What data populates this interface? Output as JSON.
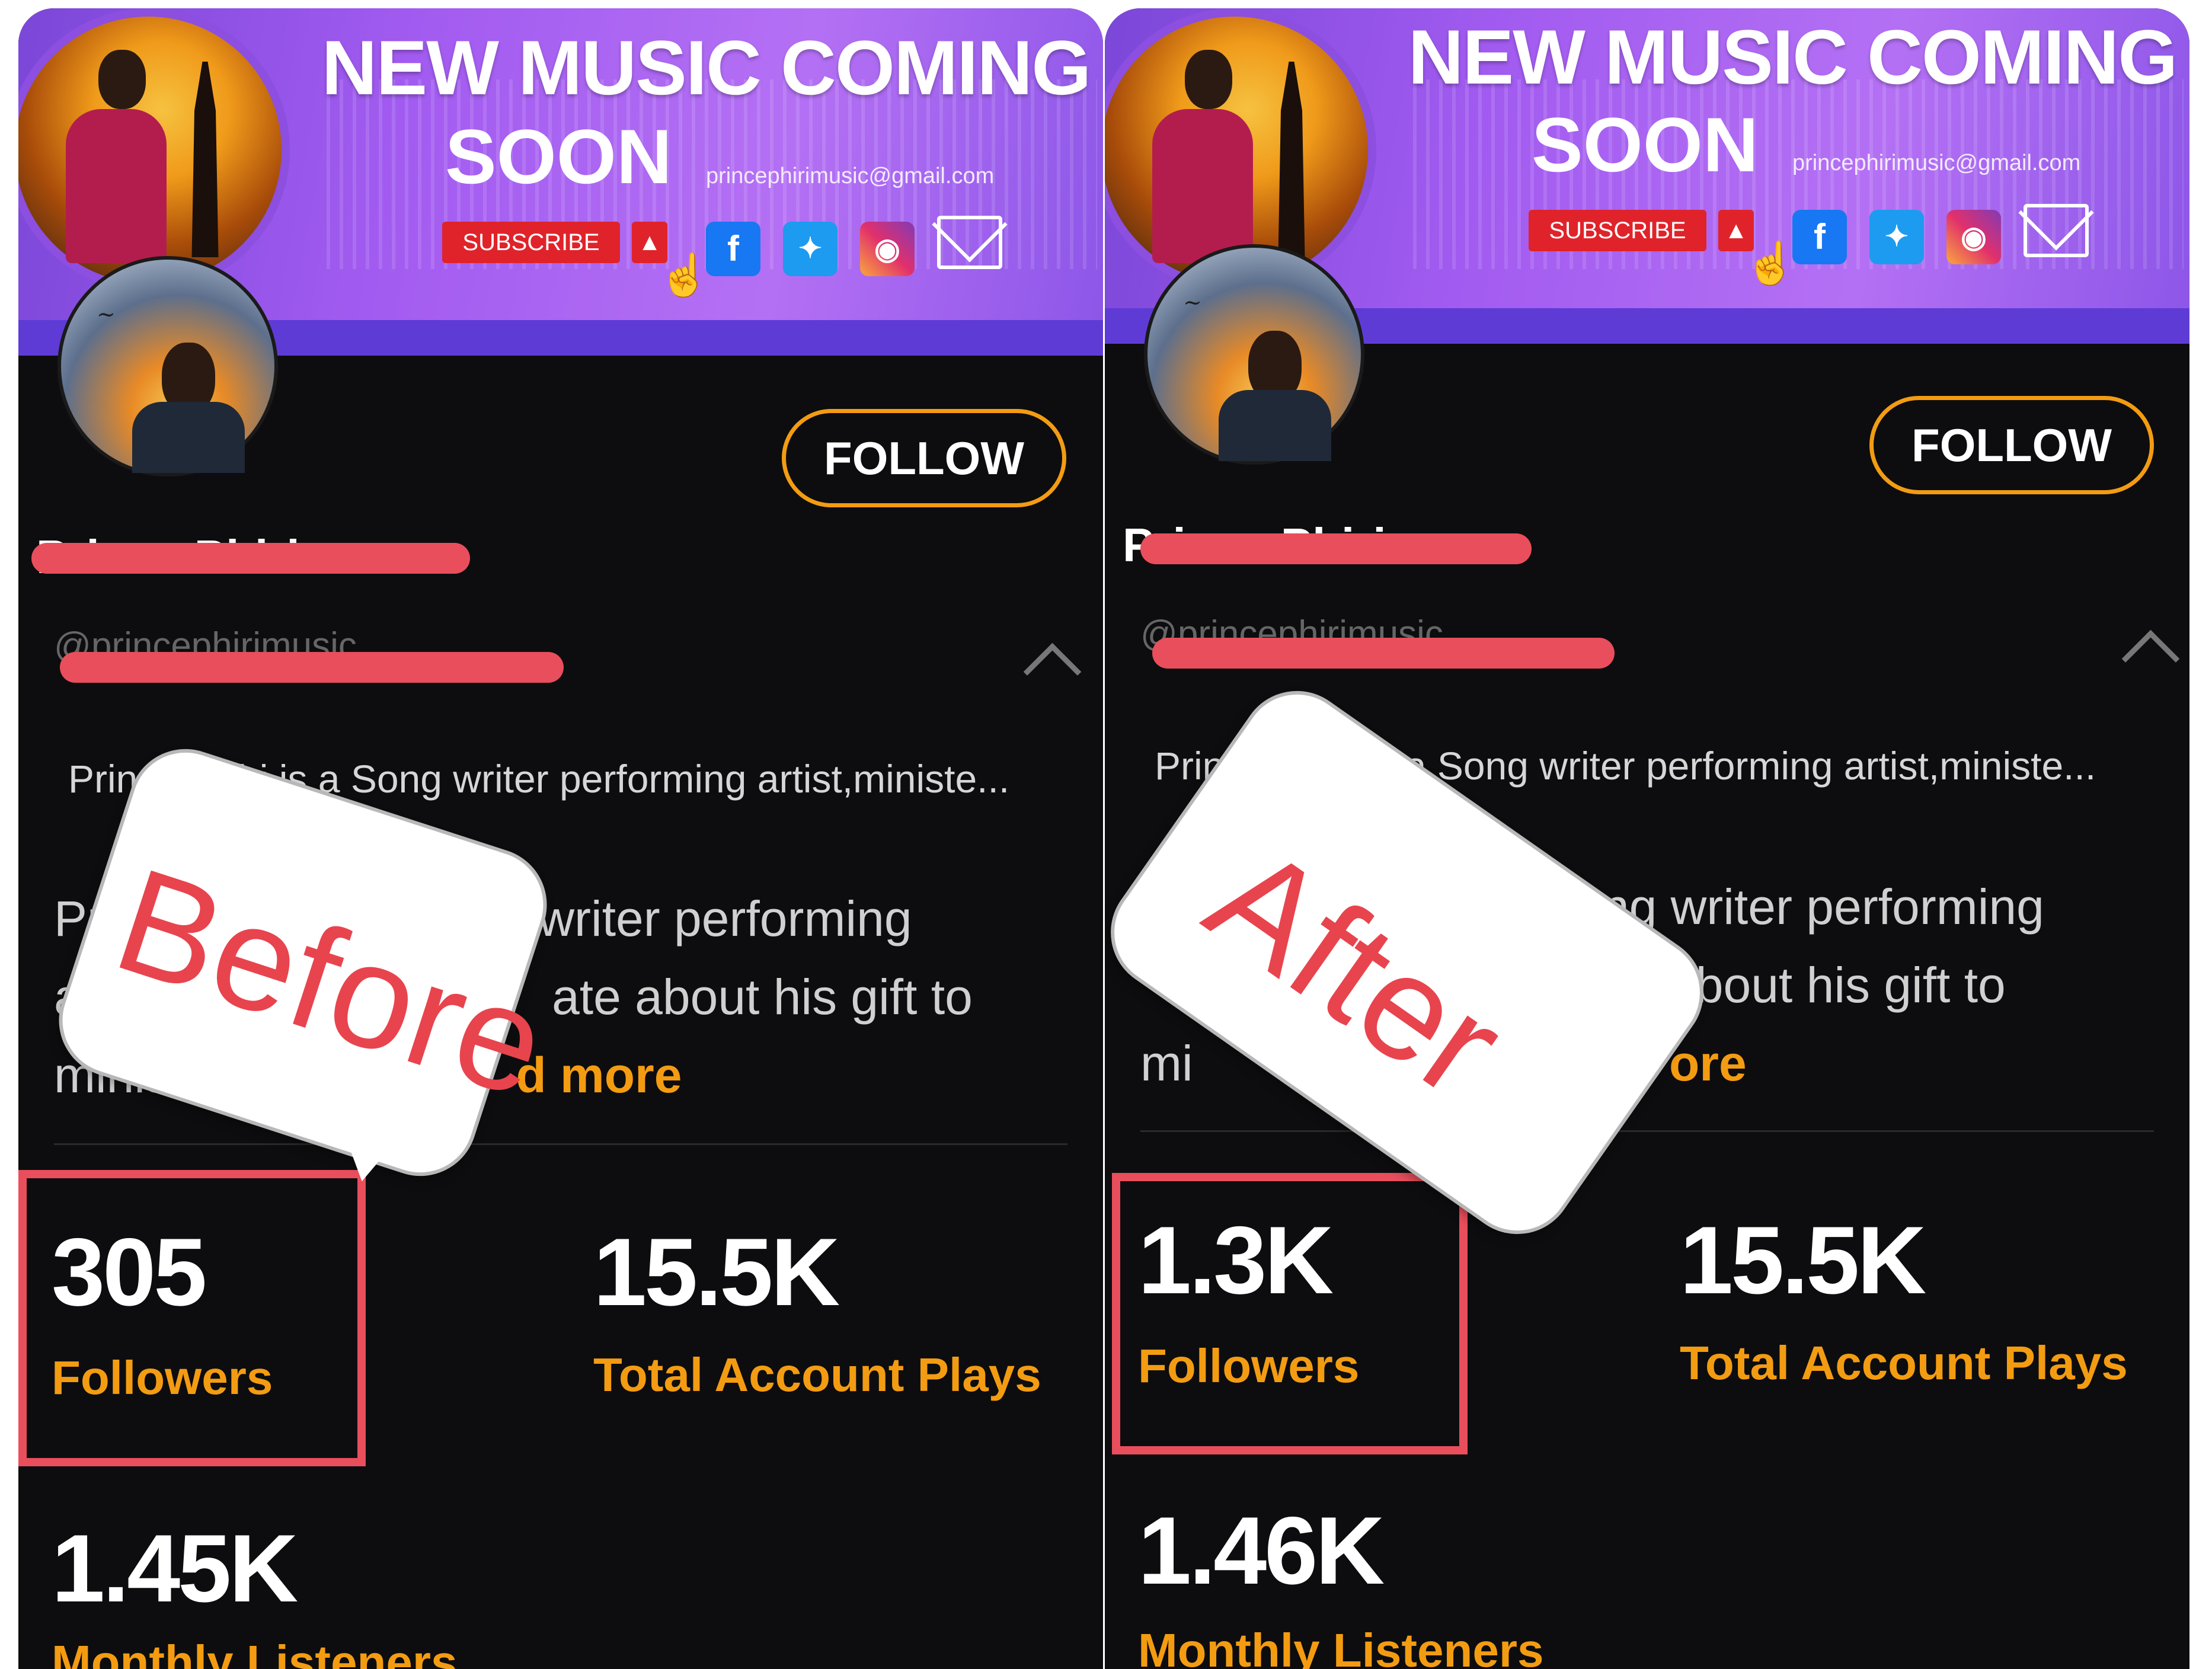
{
  "panels": {
    "before": {
      "banner": {
        "title_line1": "NEW MUSIC COMING",
        "title_line2": "SOON",
        "email": "princephirimusic@gmail.com",
        "subscribe_label": "SUBSCRIBE"
      },
      "follow_label": "FOLLOW",
      "profile_name": "Prince Phiri",
      "handle": "@princephirimusic",
      "bio_short": "Prince Phiri is a Song writer performing artist,ministe...",
      "bio_full_line1": "Pr",
      "bio_full_line1b": "g writer performing",
      "bio_full_line2": "a",
      "bio_full_line2b": "ate about his gift to",
      "bio_full_line3": "minis",
      "read_more": "d more",
      "followers_value": "305",
      "followers_label": "Followers",
      "plays_value": "15.5K",
      "plays_label": "Total Account Plays",
      "listeners_value": "1.45K",
      "listeners_label": "Monthly Listeners",
      "callout": "Before"
    },
    "after": {
      "banner": {
        "title_line1": "NEW MUSIC COMING",
        "title_line2": "SOON",
        "email": "princephirimusic@gmail.com",
        "subscribe_label": "SUBSCRIBE"
      },
      "follow_label": "FOLLOW",
      "profile_name": "Prince Phiri",
      "handle": "@princephirimusic",
      "bio_short": "Prince Phiri is a Song writer performing artist,ministe...",
      "bio_full_line1": "P",
      "bio_full_line1b": "ng writer performing",
      "bio_full_line2": "",
      "bio_full_line2b": "e about his gift to",
      "bio_full_line3": "mi",
      "read_more": "ore",
      "followers_value": "1.3K",
      "followers_label": "Followers",
      "plays_value": "15.5K",
      "plays_label": "Total Account Plays",
      "listeners_value": "1.46K",
      "listeners_label": "Monthly Listeners",
      "callout": "After"
    }
  },
  "icons": {
    "bell": "bell-icon",
    "facebook": "facebook-icon",
    "twitter": "twitter-icon",
    "instagram": "instagram-icon",
    "mail": "mail-icon",
    "chevron": "chevron-up-icon"
  },
  "colors": {
    "accent": "#f39c12",
    "highlight": "#e94e5c",
    "background": "#0d0d0f"
  }
}
